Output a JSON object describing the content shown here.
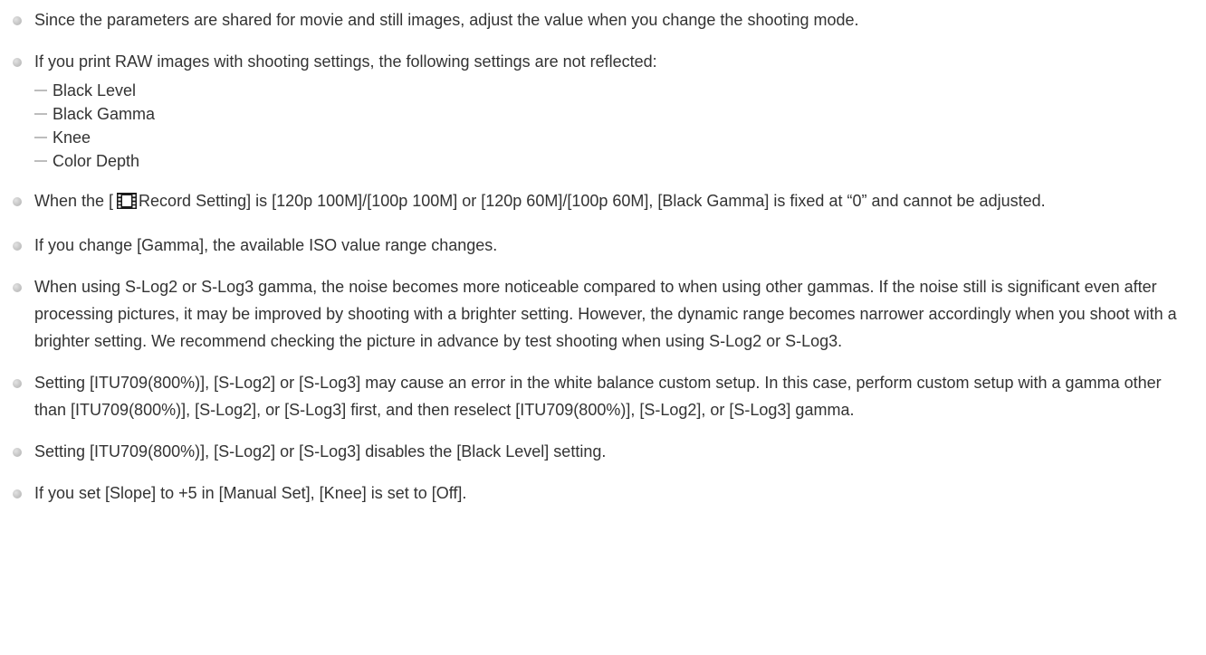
{
  "notes": [
    {
      "text": "Since the parameters are shared for movie and still images, adjust the value when you change the shooting mode."
    },
    {
      "text": "If you print RAW images with shooting settings, the following settings are not reflected:",
      "subitems": [
        "Black Level",
        "Black Gamma",
        "Knee",
        "Color Depth"
      ]
    },
    {
      "pre_icon": "When the [",
      "icon": "film-icon",
      "post_icon": "Record Setting] is [120p 100M]/[100p 100M] or [120p 60M]/[100p 60M], [Black Gamma] is fixed at “0” and cannot be adjusted."
    },
    {
      "text": "If you change [Gamma], the available ISO value range changes."
    },
    {
      "text": "When using S-Log2 or S-Log3 gamma, the noise becomes more noticeable compared to when using other gammas. If the noise still is significant even after processing pictures, it may be improved by shooting with a brighter setting. However, the dynamic range becomes narrower accordingly when you shoot with a brighter setting. We recommend checking the picture in advance by test shooting when using S-Log2 or S-Log3."
    },
    {
      "text": "Setting [ITU709(800%)], [S-Log2] or [S-Log3] may cause an error in the white balance custom setup. In this case, perform custom setup with a gamma other than [ITU709(800%)], [S-Log2], or [S-Log3] first, and then reselect [ITU709(800%)], [S-Log2], or [S-Log3] gamma."
    },
    {
      "text": "Setting [ITU709(800%)], [S-Log2] or [S-Log3] disables the [Black Level] setting."
    },
    {
      "text": "If you set [Slope] to +5 in [Manual Set], [Knee] is set to [Off]."
    }
  ]
}
